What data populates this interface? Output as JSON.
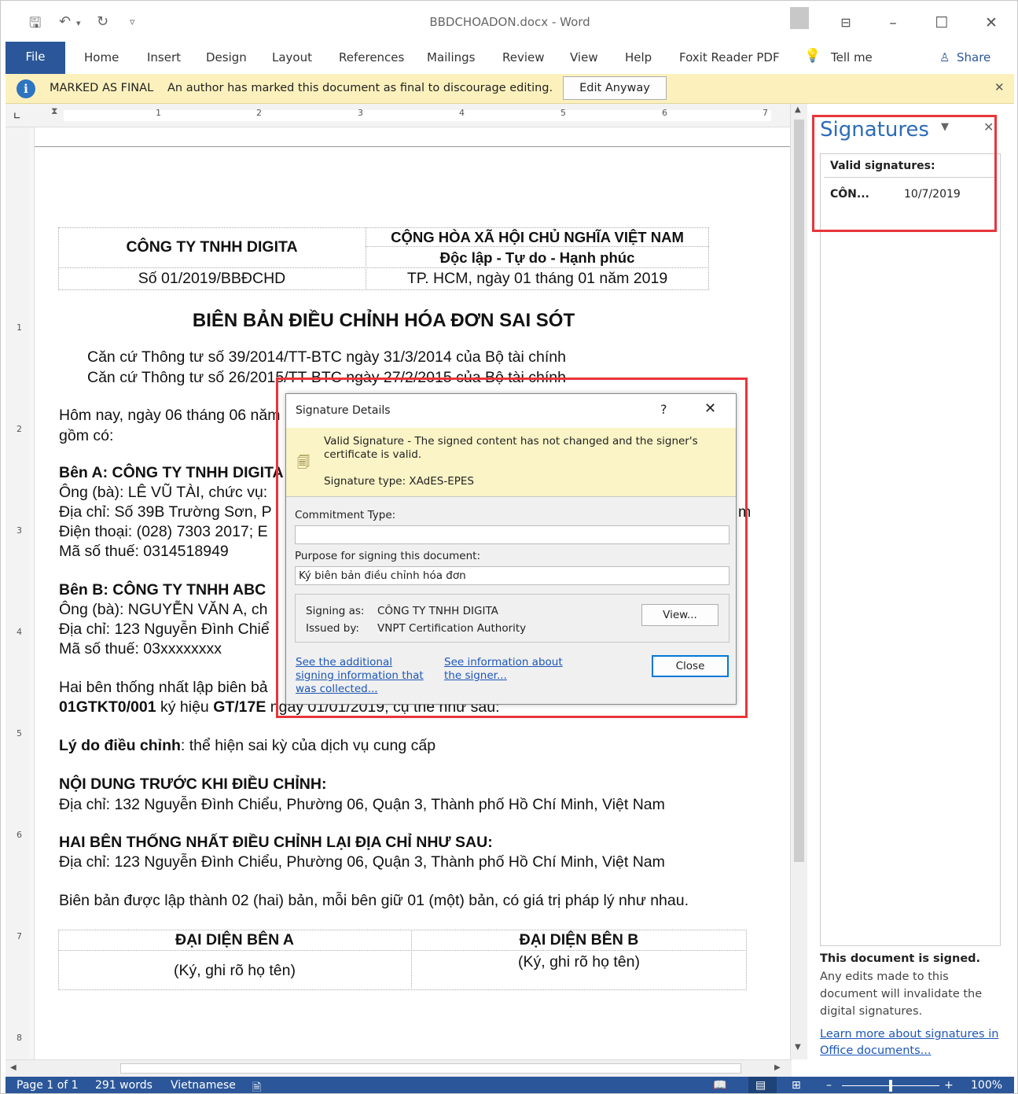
{
  "window": {
    "title": "BBDCHOADON.docx - Word"
  },
  "ribbon": {
    "tabs": [
      "File",
      "Home",
      "Insert",
      "Design",
      "Layout",
      "References",
      "Mailings",
      "Review",
      "View",
      "Help",
      "Foxit Reader PDF"
    ],
    "tell_me": "Tell me",
    "share": "Share"
  },
  "final_bar": {
    "title": "MARKED AS FINAL",
    "message": "An author has marked this document as final to discourage editing.",
    "button": "Edit Anyway"
  },
  "ruler": {
    "numbers": [
      "1",
      "2",
      "3",
      "4",
      "5",
      "6",
      "7"
    ]
  },
  "vruler": {
    "numbers": [
      "1",
      "2",
      "3",
      "4",
      "5",
      "6",
      "7",
      "8"
    ]
  },
  "doc": {
    "company": "CÔNG TY TNHH DIGITA",
    "republic": "CỘNG HÒA XÃ HỘI CHỦ NGHĨA VIỆT NAM",
    "motto": "Độc lập - Tự do  - Hạnh phúc",
    "doc_number": "Số 01/2019/BBĐCHD",
    "date_place": "TP. HCM, ngày 01 tháng 01 năm 2019",
    "title": "BIÊN BẢN ĐIỀU CHỈNH HÓA ĐƠN SAI SÓT",
    "basis1": "Căn cứ Thông tư số 39/2014/TT-BTC ngày 31/3/2014 của Bộ tài chính",
    "basis2": "Căn cứ Thông tư số 26/2015/TT-BTC ngày 27/2/2015 của Bộ tài chính",
    "today": "Hôm nay, ngày 06 tháng 06 năm",
    "attendees": "gồm có:",
    "party_a": "Bên A: CÔNG TY TNHH DIGITA",
    "party_a_rep": "Ông (bà): LÊ VŨ TÀI, chức vụ:",
    "party_a_addr": "Địa chỉ: Số 39B Trường Sơn, P",
    "party_a_addr_tail": "m",
    "party_a_phone": "Điện thoại: (028) 7303 2017; E",
    "party_a_tax": "Mã số thuế: 0314518949",
    "party_b": "Bên B: CÔNG TY TNHH ABC",
    "party_b_rep": "Ông (bà): NGUYỄN VĂN A, ch",
    "party_b_addr": "Địa chỉ: 123 Nguyễn Đình Chiể",
    "party_b_tax": "Mã số thuế: 03xxxxxxxx",
    "agree1": "Hai bên thống nhất lập biên bả",
    "invoice_form": "01GTKT0/001",
    "invoice_mid": " ký hiệu ",
    "invoice_serial": "GT/17E",
    "invoice_tail": " ngày 01/01/2019, cụ thể như sau:",
    "reason_label": "Lý do điều chỉnh",
    "reason_text": ": thể hiện sai kỳ của dịch vụ cung cấp",
    "before_heading": "NỘI DUNG TRƯỚC KHI ĐIỀU CHỈNH:",
    "before_addr": "Địa chỉ: 132 Nguyễn Đình Chiểu, Phường 06, Quận 3, Thành phố Hồ Chí Minh, Việt Nam",
    "after_heading": "HAI BÊN THỐNG NHẤT ĐIỀU CHỈNH LẠI ĐỊA CHỈ NHƯ SAU:",
    "after_addr": "Địa chỉ: 123 Nguyễn Đình Chiểu, Phường 06, Quận 3, Thành phố Hồ Chí Minh, Việt Nam",
    "closing": "Biên bản được lập thành 02 (hai) bản, mỗi bên giữ 01 (một) bản, có giá trị pháp lý như nhau.",
    "rep_a": "ĐẠI DIỆN BÊN A",
    "rep_b": "ĐẠI DIỆN BÊN B",
    "sign_a": "(Ký, ghi rõ họ tên)",
    "sign_b": "(Ký, ghi rõ họ tên)"
  },
  "pane": {
    "title": "Signatures",
    "valid_header": "Valid signatures:",
    "sig_name": "CÔN...",
    "sig_date": "10/7/2019",
    "signed_title": "This document is signed.",
    "signed_text": [
      "Any edits made to this",
      "document will invalidate the",
      "digital signatures."
    ],
    "learn_more": [
      "Learn more about signatures in",
      "Office documents..."
    ]
  },
  "dialog": {
    "title": "Signature Details",
    "help": "?",
    "valid_line1": "Valid Signature - The signed content has not changed and the signer's",
    "valid_line2": "certificate is valid.",
    "sig_type": "Signature type: XAdES-EPES",
    "commitment_label": "Commitment Type:",
    "commitment_value": "",
    "purpose_label": "Purpose for signing this document:",
    "purpose_value": "Ký biên bản điều chỉnh hóa đơn",
    "signing_as_label": "Signing as:",
    "signing_as_value": "CÔNG TY TNHH DIGITA",
    "issued_by_label": "Issued by:",
    "issued_by_value": "VNPT Certification Authority",
    "view_button": "View...",
    "link_additional": [
      "See the additional",
      "signing information that",
      "was collected..."
    ],
    "link_signer": [
      "See information about",
      "the signer..."
    ],
    "close_button": "Close"
  },
  "status": {
    "page": "Page 1 of 1",
    "words": "291 words",
    "language": "Vietnamese",
    "zoom": "100%"
  }
}
